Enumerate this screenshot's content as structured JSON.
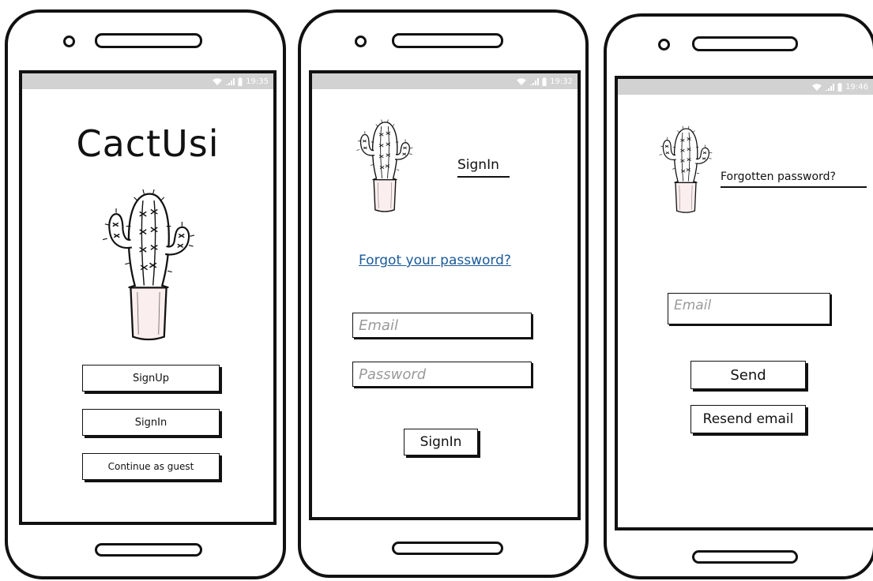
{
  "status_bar": {
    "time_1": "19:35",
    "time_2": "19:32",
    "time_3": "19:46"
  },
  "welcome_screen": {
    "app_title": "CactUsi",
    "signup_label": "SignUp",
    "signin_label": "SignIn",
    "guest_label": "Continue as guest"
  },
  "signin_screen": {
    "title": "SignIn",
    "forgot_link": "Forgot your password?",
    "email_placeholder": "Email",
    "password_placeholder": "Password",
    "signin_button": "SignIn"
  },
  "forgot_screen": {
    "title": "Forgotten password?",
    "email_placeholder": "Email",
    "send_button": "Send",
    "resend_button": "Resend email"
  },
  "icons": [
    "camera-icon",
    "speaker-icon",
    "wifi-icon",
    "signal-icon",
    "battery-icon",
    "cactus-icon",
    "home-button-icon"
  ],
  "colors": {
    "status_bar": "#d2d2d2",
    "pot": "#fbeeee",
    "link": "#1a5a99",
    "placeholder": "#9a9a9a"
  }
}
